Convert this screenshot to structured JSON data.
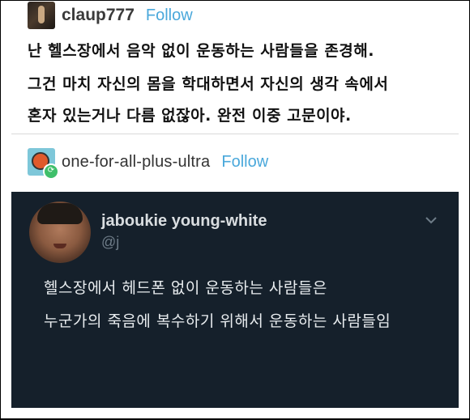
{
  "post1": {
    "username": "claup777",
    "follow_label": "Follow",
    "lines": [
      "난 헬스장에서 음악 없이 운동하는 사람들을 존경해.",
      "그건 마치 자신의 몸을 학대하면서 자신의 생각 속에서",
      "혼자 있는거나 다름 없잖아. 완전 이중 고문이야."
    ]
  },
  "post2": {
    "username": "one-for-all-plus-ultra",
    "follow_label": "Follow"
  },
  "tweet": {
    "name": "jaboukie young-white",
    "handle": "@j",
    "lines": [
      "헬스장에서 헤드폰 없이 운동하는 사람들은",
      "누군가의 죽음에 복수하기 위해서 운동하는 사람들임"
    ]
  },
  "colors": {
    "follow": "#4aa8db",
    "tweet_bg": "#15202b",
    "divider": "#d9d9d9"
  },
  "icons": {
    "avatar1": "user-avatar",
    "avatar2": "reblog-avatar",
    "reblog_badge": "reblog-icon",
    "tweet_menu": "chevron-down-icon"
  }
}
